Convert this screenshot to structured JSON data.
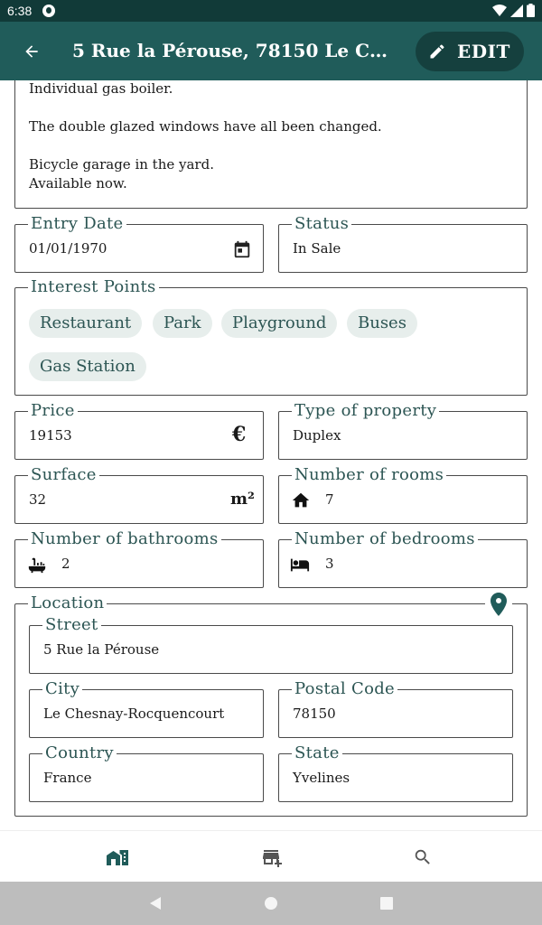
{
  "status_bar": {
    "time": "6:38"
  },
  "app_bar": {
    "title": "5 Rue la Pérouse, 78150 Le Chesnay-Rocquencourt",
    "edit_label": "EDIT"
  },
  "description": {
    "lines": [
      "Individual gas boiler.",
      "The double glazed windows have all been changed.",
      "Bicycle garage in the yard.",
      "Available now."
    ]
  },
  "entry_date": {
    "label": "Entry Date",
    "value": "01/01/1970"
  },
  "status": {
    "label": "Status",
    "value": "In Sale"
  },
  "interest_points": {
    "label": "Interest Points",
    "chips": [
      "Restaurant",
      "Park",
      "Playground",
      "Buses",
      "Gas Station"
    ]
  },
  "price": {
    "label": "Price",
    "value": "19153",
    "unit": "€"
  },
  "type_of_property": {
    "label": "Type of property",
    "value": "Duplex"
  },
  "surface": {
    "label": "Surface",
    "value": "32",
    "unit": "m²"
  },
  "rooms": {
    "label": "Number of rooms",
    "value": "7"
  },
  "bathrooms": {
    "label": "Number of bathrooms",
    "value": "2"
  },
  "bedrooms": {
    "label": "Number of bedrooms",
    "value": "3"
  },
  "location": {
    "label": "Location",
    "street": {
      "label": "Street",
      "value": "5 Rue la Pérouse"
    },
    "city": {
      "label": "City",
      "value": "Le Chesnay-Rocquencourt"
    },
    "postal_code": {
      "label": "Postal Code",
      "value": "78150"
    },
    "country": {
      "label": "Country",
      "value": "France"
    },
    "state": {
      "label": "State",
      "value": "Yvelines"
    }
  },
  "bottom_nav": {
    "icons": [
      "home-city-icon",
      "store-plus-icon",
      "search-icon"
    ],
    "active_index": 0
  },
  "colors": {
    "primary": "#205c5a",
    "primary_dark": "#15403e",
    "status_bar": "#113a38",
    "chip_bg": "#e7eeec",
    "legend_text": "#2c5553"
  }
}
